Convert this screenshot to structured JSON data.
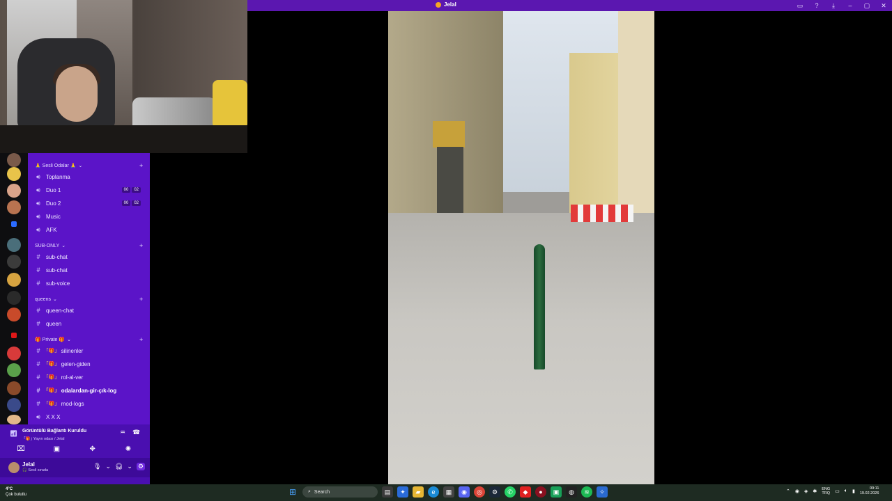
{
  "window": {
    "title": "Jelal"
  },
  "sidebar": {
    "categories": [
      {
        "label": "🙏 Sesli Odalar 🙏"
      },
      {
        "label": "SUB-ONLY"
      },
      {
        "label": "queens"
      },
      {
        "label": "🎁 Private 🎁"
      }
    ],
    "channels": [
      {
        "name": "Toplanma",
        "type": "voice"
      },
      {
        "name": "Duo 1",
        "type": "voice",
        "badges": [
          "00",
          "02"
        ]
      },
      {
        "name": "Duo 2",
        "type": "voice",
        "badges": [
          "00",
          "02"
        ]
      },
      {
        "name": "Music",
        "type": "voice"
      },
      {
        "name": "AFK",
        "type": "voice"
      },
      {
        "name": "sub-chat",
        "type": "text"
      },
      {
        "name": "sub-chat",
        "type": "text"
      },
      {
        "name": "sub-voice",
        "type": "text"
      },
      {
        "name": "queen-chat",
        "type": "text"
      },
      {
        "name": "queen",
        "type": "text"
      },
      {
        "name": "silinenler",
        "type": "text",
        "prefix": "｢🎁｣"
      },
      {
        "name": "gelen-giden",
        "type": "text",
        "prefix": "｢🎁｣"
      },
      {
        "name": "rol-al-ver",
        "type": "text",
        "prefix": "｢🎁｣"
      },
      {
        "name": "odalardan-gir-çık-log",
        "type": "text",
        "prefix": "｢🎁｣"
      },
      {
        "name": "mod-logs",
        "type": "text",
        "prefix": "｢🎁｣"
      },
      {
        "name": "X X X",
        "type": "voice"
      }
    ]
  },
  "voice_panel": {
    "status": "Görüntülü Bağlantı Kuruldu",
    "location": "｢🎁｣ Yayın odası / Jelal"
  },
  "user_panel": {
    "name": "Jelal",
    "status": "🎧 Sesli sırada"
  },
  "taskbar": {
    "weather_temp": "4°C",
    "weather_desc": "Çok bulutlu",
    "search_placeholder": "Search",
    "lang_top": "ENG",
    "lang_bottom": "TRQ",
    "time": "09:11",
    "date": "19.02.2026"
  }
}
